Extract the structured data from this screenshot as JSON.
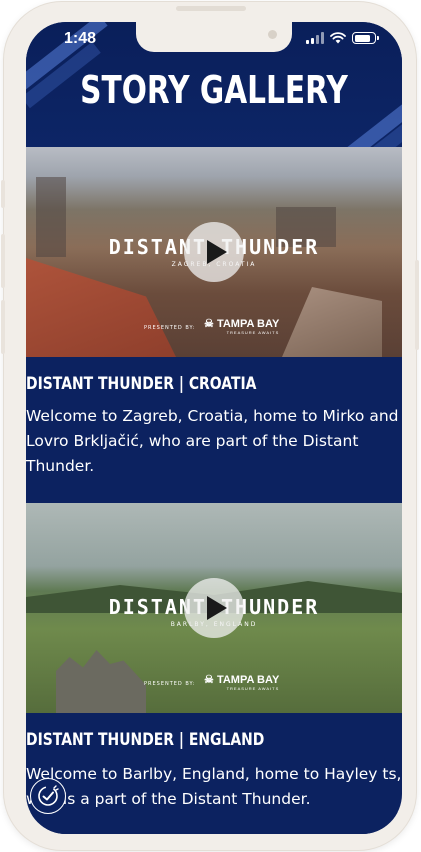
{
  "status_bar": {
    "time": "1:48"
  },
  "page": {
    "title": "STORY GALLERY"
  },
  "stories": [
    {
      "video_title": "DISTANT THUNDER",
      "video_location": "ZAGREB, CROATIA",
      "presented_by": "PRESENTED BY:",
      "presenter": "TAMPA BAY",
      "presenter_tagline": "TREASURE AWAITS",
      "heading": "DISTANT THUNDER | CROATIA",
      "description": "Welcome to Zagreb, Croatia, home to Mirko and Lovro Brkljačić, who are part of the Distant Thunder."
    },
    {
      "video_title": "DISTANT THUNDER",
      "video_location": "BARLBY, ENGLAND",
      "presented_by": "PRESENTED BY:",
      "presenter": "TAMPA BAY",
      "presenter_tagline": "TREASURE AWAITS",
      "heading": "DISTANT THUNDER | ENGLAND",
      "description": "Welcome to Barlby, England, home to Hayley ts, who is a part of the Distant Thunder."
    }
  ],
  "icons": {
    "play": "play-icon",
    "badge": "badge-check-icon",
    "presenter_logo": "crossed-swords-skull-icon"
  },
  "colors": {
    "background": "#0c2260",
    "text": "#ffffff",
    "frame": "#f2eee9"
  }
}
